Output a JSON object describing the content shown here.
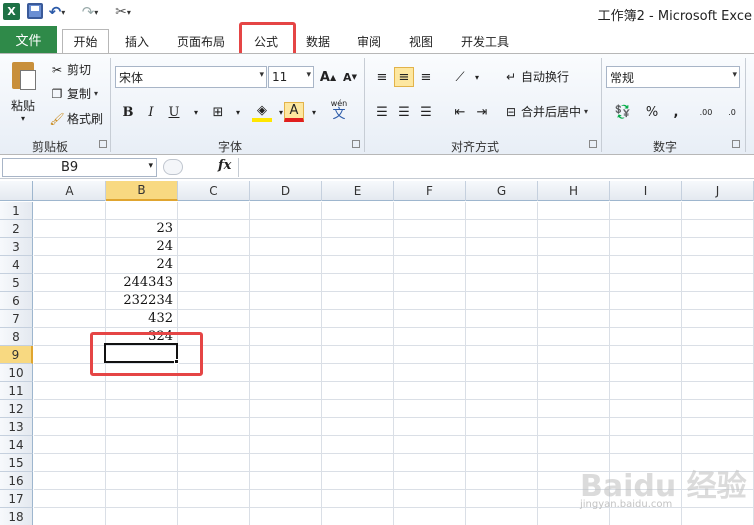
{
  "window": {
    "title": "工作簿2 - Microsoft Exce"
  },
  "quick_access": {
    "app_icon_letter": "X",
    "icons": [
      "save-icon",
      "undo-icon",
      "redo-icon",
      "customize-icon"
    ]
  },
  "ribbon_tabs": {
    "file": "文件",
    "items": [
      "开始",
      "插入",
      "页面布局",
      "公式",
      "数据",
      "审阅",
      "视图",
      "开发工具"
    ],
    "active": "开始"
  },
  "clipboard": {
    "paste": "粘贴",
    "cut": "剪切",
    "copy": "复制",
    "format_painter": "格式刷",
    "group_label": "剪贴板"
  },
  "font": {
    "family": "宋体",
    "size": "11",
    "grow": "A",
    "shrink": "A",
    "bold": "B",
    "italic": "I",
    "underline": "U",
    "font_color": "A",
    "phonetic": "wén",
    "phonetic_char": "文",
    "group_label": "字体"
  },
  "alignment": {
    "wrap_text": "自动换行",
    "merge_center": "合并后居中",
    "group_label": "对齐方式"
  },
  "number": {
    "format": "常规",
    "percent": "%",
    "comma": ",",
    "increase_decimal": ".00",
    "decrease_decimal": ".0",
    "group_label": "数字"
  },
  "formula_bar": {
    "name_box": "B9",
    "fx": "fx",
    "value": ""
  },
  "grid": {
    "columns": [
      "A",
      "B",
      "C",
      "D",
      "E",
      "F",
      "G",
      "H",
      "I",
      "J"
    ],
    "rows": [
      "1",
      "2",
      "3",
      "4",
      "5",
      "6",
      "7",
      "8",
      "9",
      "10",
      "11",
      "12",
      "13",
      "14",
      "15",
      "16",
      "17",
      "18"
    ],
    "selected_column": "B",
    "selected_row": "9",
    "cells_B": {
      "B2": "23",
      "B3": "24",
      "B4": "24",
      "B5": "244343",
      "B6": "232234",
      "B7": "432",
      "B8": "324"
    }
  },
  "watermark": {
    "text": "Baidu 经验",
    "sub": "jingyan.baidu.com"
  },
  "colors": {
    "file_tab": "#2f8a49",
    "highlight": "#e54545",
    "selection": "#f8d981"
  }
}
